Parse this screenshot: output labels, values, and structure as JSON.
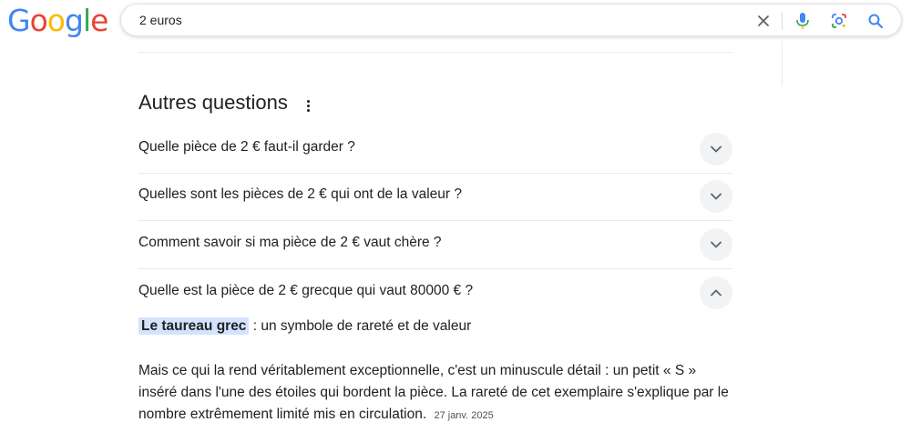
{
  "logo": {
    "letters": [
      "G",
      "o",
      "o",
      "g",
      "l",
      "e"
    ],
    "colors": [
      "#4285F4",
      "#EA4335",
      "#FBBC05",
      "#4285F4",
      "#34A853",
      "#EA4335"
    ]
  },
  "search": {
    "value": "2 euros"
  },
  "icons": {
    "clear": "close-icon",
    "voice": "microphone-icon",
    "lens": "lens-icon",
    "search": "search-icon"
  },
  "section": {
    "title": "Autres questions"
  },
  "questions": [
    {
      "text": "Quelle pièce de 2 € faut-il garder ?",
      "expanded": false
    },
    {
      "text": "Quelles sont les pièces de 2 € qui ont de la valeur ?",
      "expanded": false
    },
    {
      "text": "Comment savoir si ma pièce de 2 € vaut chère ?",
      "expanded": false
    },
    {
      "text": "Quelle est la pièce de 2 € grecque qui vaut 80000 € ?",
      "expanded": true
    }
  ],
  "answer": {
    "highlight": "Le taureau grec",
    "headline_rest": " : un symbole de rareté et de valeur",
    "paragraph": "Mais ce qui la rend véritablement exceptionnelle, c'est un minuscule détail : un petit « S » inséré dans l'une des étoiles qui bordent la pièce. La rareté de cet exemplaire s'explique par le nombre extrêmement limité mis en circulation.",
    "date": "27 janv. 2025"
  },
  "colors": {
    "accent": "#1a73e8",
    "highlight": "#d3e3fd",
    "chevron_bg": "#f1f3f4"
  }
}
